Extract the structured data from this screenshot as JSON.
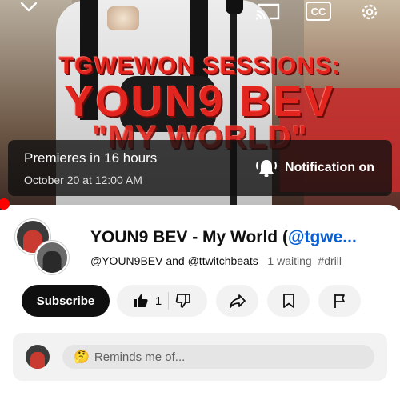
{
  "video": {
    "overlay_line1": "TGWEWON SESSIONS:",
    "overlay_line2": "YOUN9 BEV",
    "overlay_line3": "\"MY WORLD\"",
    "premiere_title": "Premieres in 16 hours",
    "premiere_date": "October 20 at 12:00 AM",
    "notification_label": "Notification on",
    "progress_fraction": 0.0
  },
  "top_icons": [
    "chevron-down-icon",
    "cast-icon",
    "closed-captions-icon",
    "settings-icon"
  ],
  "cc_label": "CC",
  "info": {
    "title_prefix": "YOUN9 BEV - My World (",
    "title_handle": "@tgwe...",
    "owners": "@YOUN9BEV and @ttwitchbeats",
    "waiting": "1 waiting",
    "hashtag": "#drill"
  },
  "actions": {
    "subscribe_label": "Subscribe",
    "like_count": "1"
  },
  "comment": {
    "emoji": "🤔",
    "placeholder": "Reminds me of..."
  },
  "colors": {
    "accent_red": "#ff0000",
    "link_blue": "#065fd4",
    "subscribe_bg": "#0f0f0f"
  }
}
